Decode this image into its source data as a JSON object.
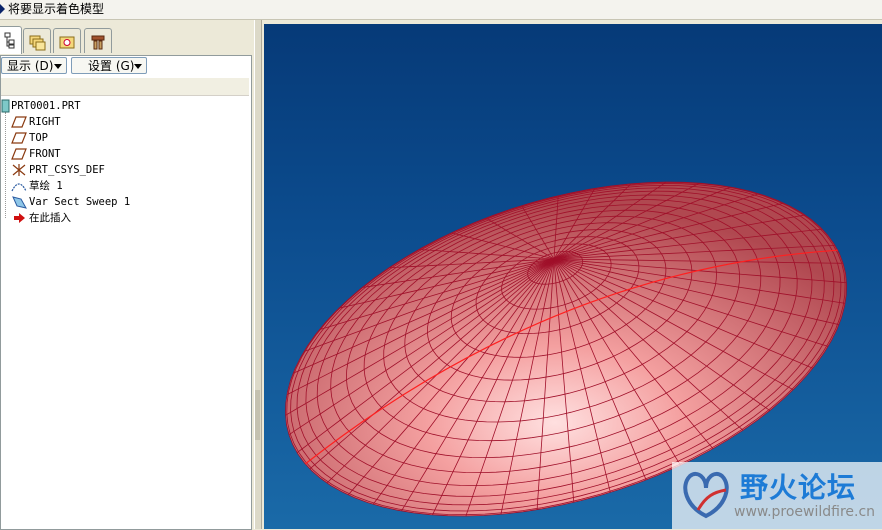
{
  "status_bar": {
    "message": "将要显示着色模型"
  },
  "tabs": [
    {
      "name": "model-tree",
      "icon": "model-tree-icon",
      "active": true
    },
    {
      "name": "folder-browser",
      "icon": "folder-browser-icon",
      "active": false
    },
    {
      "name": "favorites",
      "icon": "favorites-icon",
      "active": false
    },
    {
      "name": "connections",
      "icon": "connections-icon",
      "active": false
    }
  ],
  "toolbar": {
    "display_label": "显示 (D)",
    "settings_label": "设置 (G)"
  },
  "model_tree": {
    "root": "PRT0001.PRT",
    "items": [
      {
        "label": "RIGHT",
        "icon": "datum-plane-icon"
      },
      {
        "label": "TOP",
        "icon": "datum-plane-icon"
      },
      {
        "label": "FRONT",
        "icon": "datum-plane-icon"
      },
      {
        "label": "PRT_CSYS_DEF",
        "icon": "csys-icon"
      },
      {
        "label": "草绘 1",
        "icon": "sketch-icon"
      },
      {
        "label": "Var Sect Sweep 1",
        "icon": "sweep-icon"
      },
      {
        "label": "在此插入",
        "icon": "insert-here-icon"
      }
    ]
  },
  "viewport": {
    "background_top": "#063a78",
    "background_bottom": "#1a6aa8",
    "surface_color": "#f08a8a",
    "mesh_color": "#a0102a"
  },
  "watermark": {
    "title": "野火论坛",
    "url": "www.proewildfire.cn"
  }
}
